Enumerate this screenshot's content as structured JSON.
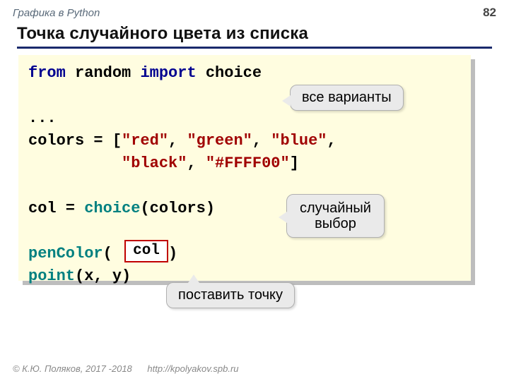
{
  "header": {
    "topic": "Графика в Python",
    "page": "82",
    "title": "Точка случайного цвета из списка"
  },
  "code": {
    "l1a": "from",
    "l1b": " random ",
    "l1c": "import",
    "l1d": " choice",
    "l2": "",
    "l3": "...",
    "l4a": "colors = [",
    "l4b": "\"red\"",
    "l4c": ", ",
    "l4d": "\"green\"",
    "l4e": ", ",
    "l4f": "\"blue\"",
    "l4g": ",",
    "l5a": "          ",
    "l5b": "\"black\"",
    "l5c": ", ",
    "l5d": "\"#FFFF00\"",
    "l5e": "]",
    "gap": "",
    "l6a": "col = ",
    "l6b": "choice",
    "l6c": "(colors)",
    "gap2": "",
    "l7a": "penColor",
    "l7b": "(      )",
    "l8a": "point",
    "l8b": "(x, y)"
  },
  "highlight": "col",
  "callouts": {
    "all_variants": "все варианты",
    "random_choice_l1": "случайный",
    "random_choice_l2": "выбор",
    "put_point": "поставить точку"
  },
  "footer": {
    "copyright": "© К.Ю. Поляков, 2017 -2018",
    "url": "http://kpolyakov.spb.ru"
  }
}
